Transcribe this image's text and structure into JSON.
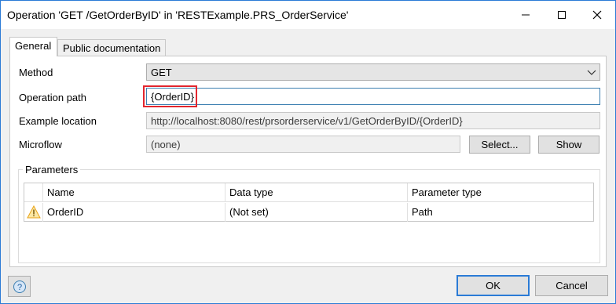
{
  "window": {
    "title": "Operation 'GET /GetOrderByID' in 'RESTExample.PRS_OrderService'"
  },
  "tabs": [
    {
      "label": "General",
      "active": true
    },
    {
      "label": "Public documentation",
      "active": false
    }
  ],
  "form": {
    "method_label": "Method",
    "method_value": "GET",
    "operation_path_label": "Operation path",
    "operation_path_value": "{OrderID}",
    "example_location_label": "Example location",
    "example_location_value": "http://localhost:8080/rest/prsorderservice/v1/GetOrderByID/{OrderID}",
    "microflow_label": "Microflow",
    "microflow_value": "(none)",
    "select_button": "Select...",
    "show_button": "Show"
  },
  "parameters": {
    "title": "Parameters",
    "columns": [
      "Name",
      "Data type",
      "Parameter type"
    ],
    "rows": [
      {
        "icon": "warning-icon",
        "name": "OrderID",
        "data_type": "(Not set)",
        "parameter_type": "Path"
      }
    ]
  },
  "footer": {
    "help_icon": "help-icon",
    "ok_button": "OK",
    "cancel_button": "Cancel"
  },
  "colors": {
    "accent": "#2b7bd6",
    "highlight": "#e3262e",
    "warning": "#e8a317"
  }
}
